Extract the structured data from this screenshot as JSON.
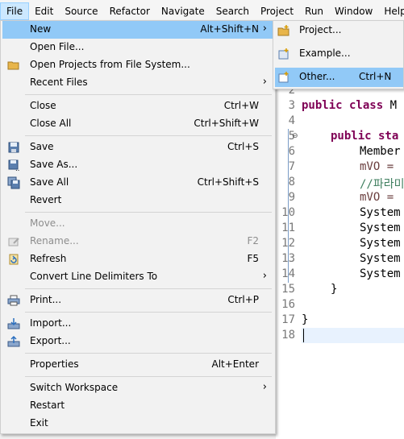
{
  "menubar": {
    "items": [
      "File",
      "Edit",
      "Source",
      "Refactor",
      "Navigate",
      "Search",
      "Project",
      "Run",
      "Window",
      "Help"
    ]
  },
  "file_menu": {
    "new": {
      "label": "New",
      "shortcut": "Alt+Shift+N"
    },
    "open_file": {
      "label": "Open File..."
    },
    "open_projects": {
      "label": "Open Projects from File System..."
    },
    "recent_files": {
      "label": "Recent Files"
    },
    "close": {
      "label": "Close",
      "shortcut": "Ctrl+W"
    },
    "close_all": {
      "label": "Close All",
      "shortcut": "Ctrl+Shift+W"
    },
    "save": {
      "label": "Save",
      "shortcut": "Ctrl+S"
    },
    "save_as": {
      "label": "Save As..."
    },
    "save_all": {
      "label": "Save All",
      "shortcut": "Ctrl+Shift+S"
    },
    "revert": {
      "label": "Revert"
    },
    "move": {
      "label": "Move..."
    },
    "rename": {
      "label": "Rename...",
      "shortcut": "F2"
    },
    "refresh": {
      "label": "Refresh",
      "shortcut": "F5"
    },
    "convert": {
      "label": "Convert Line Delimiters To"
    },
    "print": {
      "label": "Print...",
      "shortcut": "Ctrl+P"
    },
    "import": {
      "label": "Import..."
    },
    "export": {
      "label": "Export..."
    },
    "properties": {
      "label": "Properties",
      "shortcut": "Alt+Enter"
    },
    "switch_workspace": {
      "label": "Switch Workspace"
    },
    "restart": {
      "label": "Restart"
    },
    "exit": {
      "label": "Exit"
    }
  },
  "new_submenu": {
    "project": {
      "label": "Project..."
    },
    "example": {
      "label": "Example..."
    },
    "other": {
      "label": "Other...",
      "shortcut": "Ctrl+N"
    }
  },
  "editor": {
    "line_numbers": [
      "2",
      "3",
      "4",
      "5",
      "6",
      "7",
      "8",
      "9",
      "10",
      "11",
      "12",
      "13",
      "14",
      "15",
      "16",
      "17",
      "18"
    ],
    "lines": {
      "l3_kw": "public class",
      "l3_rest": " M",
      "l5_kw": "public sta",
      "l6": "Member",
      "l7": "mVO =",
      "l8": "//파라미",
      "l9": "mVO =",
      "l10": "System",
      "l11": "System",
      "l12": "System",
      "l13": "System",
      "l14": "System",
      "l15": "}",
      "l17": "}"
    }
  },
  "colors": {
    "highlight": "#91c9f7",
    "keyword": "#7f0055",
    "comment": "#3f7f5f"
  }
}
